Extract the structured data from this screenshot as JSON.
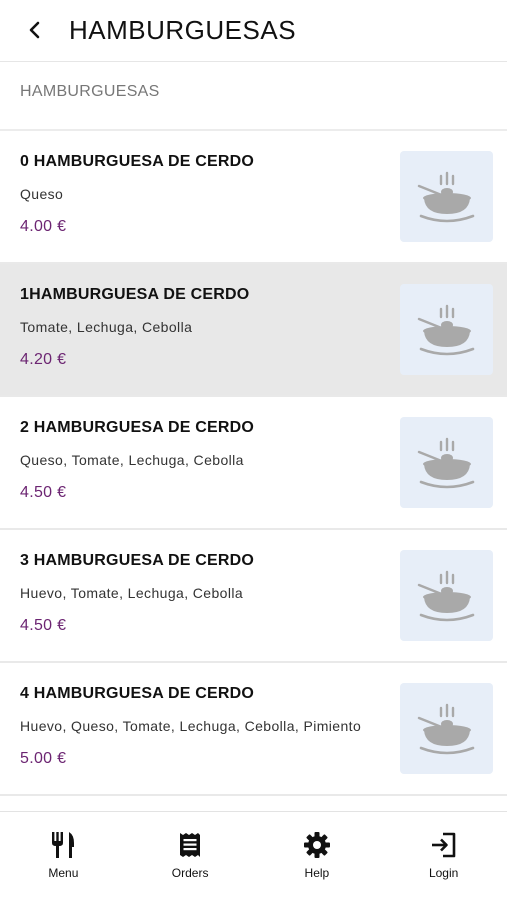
{
  "header": {
    "title": "HAMBURGUESAS"
  },
  "section": {
    "label": "HAMBURGUESAS"
  },
  "items": [
    {
      "title": "0 HAMBURGUESA DE CERDO",
      "desc": "Queso",
      "price": "4.00 €"
    },
    {
      "title": "1HAMBURGUESA DE CERDO",
      "desc": "Tomate, Lechuga, Cebolla",
      "price": "4.20 €"
    },
    {
      "title": "2 HAMBURGUESA DE CERDO",
      "desc": "Queso, Tomate, Lechuga, Cebolla",
      "price": "4.50 €"
    },
    {
      "title": "3 HAMBURGUESA DE CERDO",
      "desc": "Huevo, Tomate, Lechuga, Cebolla",
      "price": "4.50 €"
    },
    {
      "title": "4 HAMBURGUESA DE CERDO",
      "desc": "Huevo, Queso, Tomate, Lechuga, Cebolla, Pimiento",
      "price": "5.00 €"
    }
  ],
  "nav": {
    "menu": "Menu",
    "orders": "Orders",
    "help": "Help",
    "login": "Login"
  },
  "colors": {
    "price": "#6c2572",
    "highlight_row": "#e8e8e8",
    "thumb_bg": "#e7eef8"
  },
  "icons": {
    "back": "chevron-left-icon",
    "thumb": "bowl-icon",
    "menu": "fork-knife-icon",
    "orders": "receipt-icon",
    "help": "gear-icon",
    "login": "login-icon"
  }
}
